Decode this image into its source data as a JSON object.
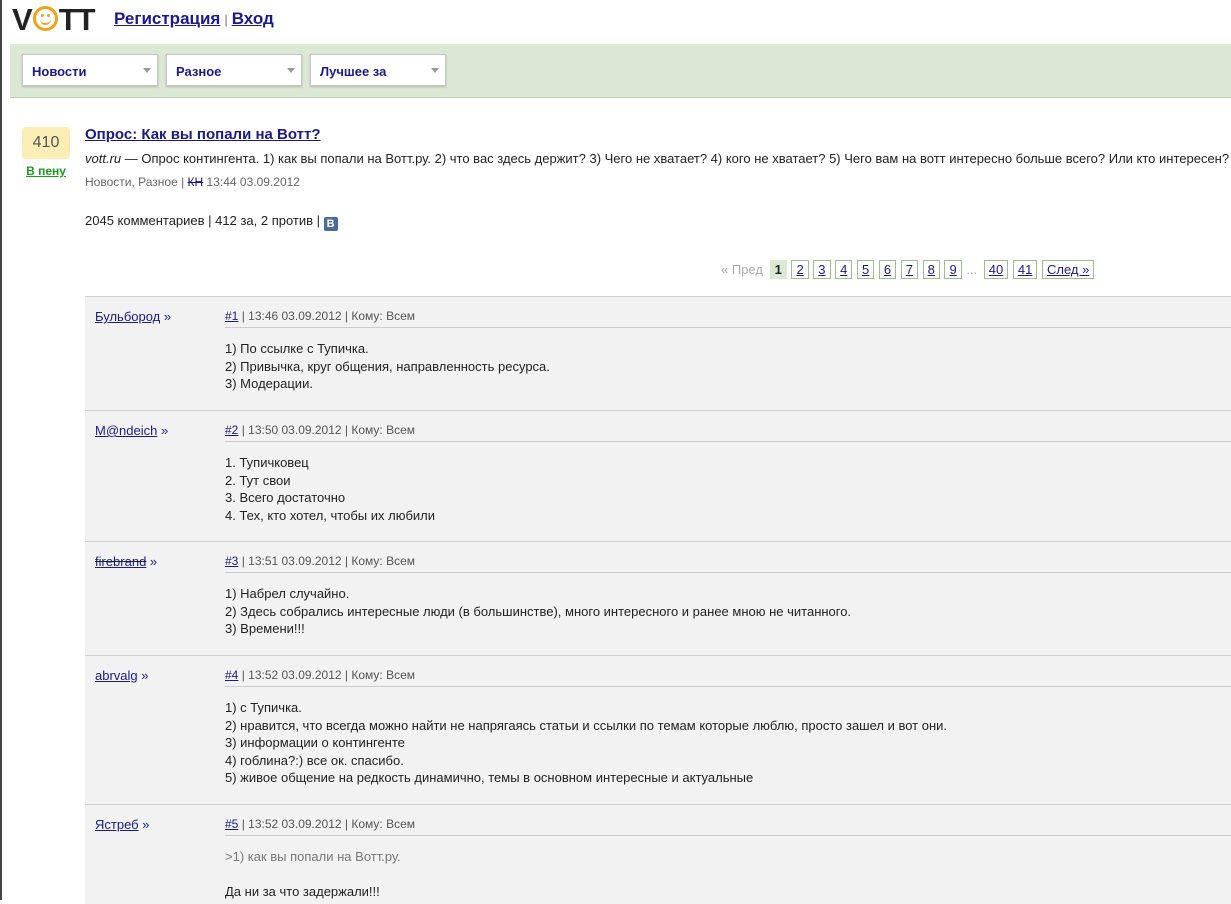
{
  "header": {
    "logo": {
      "part1": "V",
      "part2": "TT"
    },
    "register": "Регистрация",
    "separator": "|",
    "login": "Вход"
  },
  "nav": {
    "dropdowns": [
      {
        "label": "Новости"
      },
      {
        "label": "Разное"
      },
      {
        "label": "Лучшее за"
      }
    ]
  },
  "post": {
    "score": "410",
    "to_foam": "В пену",
    "title": "Опрос: Как вы попали на Вотт?",
    "source": "vott.ru",
    "description": " — Опрос контингента. 1) как вы попали на Вотт.ру. 2) что вас здесь держит? 3) Чего не хватает? 4) кого не хватает? 5) Чего вам на вотт интересно больше всего? Или кто интересен?",
    "categories": "Новости, Разное |",
    "author": "КН",
    "datetime": "13:44 03.09.2012",
    "stats": "2045 комментариев | 412 за, 2 против |",
    "vk_icon": "В"
  },
  "pager": {
    "prev": "« Пред",
    "pages": [
      "1",
      "2",
      "3",
      "4",
      "5",
      "6",
      "7",
      "8",
      "9"
    ],
    "dots": "...",
    "last_pages": [
      "40",
      "41"
    ],
    "next": "След »"
  },
  "comments": [
    {
      "author": "Бульбород",
      "author_strike": false,
      "num": "#1",
      "meta": " | 13:46 03.09.2012 | Кому: Всем",
      "lines": [
        "1) По ссылке с Тупичка.",
        "2) Привычка, круг общения, направленность ресурса.",
        "3) Модерации."
      ]
    },
    {
      "author": "M@ndeich",
      "author_strike": false,
      "num": "#2",
      "meta": " | 13:50 03.09.2012 | Кому: Всем",
      "lines": [
        "1. Тупичковец",
        "2. Тут свои",
        "3. Всего достаточно",
        "4. Тех, кто хотел, чтобы их любили"
      ]
    },
    {
      "author": "firebrand",
      "author_strike": true,
      "num": "#3",
      "meta": " | 13:51 03.09.2012 | Кому: Всем",
      "lines": [
        "1) Набрел случайно.",
        "2) Здесь собрались интересные люди (в большинстве), много интересного и ранее мною не читанного.",
        "3) Времени!!!"
      ]
    },
    {
      "author": "abrvalg",
      "author_strike": false,
      "num": "#4",
      "meta": " | 13:52 03.09.2012 | Кому: Всем",
      "lines": [
        "1) с Тупичка.",
        "2) нравится, что всегда можно найти не напрягаясь статьи и ссылки по темам которые люблю, просто зашел и вот они.",
        "3) информации о контингенте",
        "4) гоблина?:) все ок. спасибо.",
        "5) живое общение на редкость динамично, темы в основном интересные и актуальные"
      ]
    },
    {
      "author": "Ястреб",
      "author_strike": false,
      "num": "#5",
      "meta": " | 13:52 03.09.2012 | Кому: Всем",
      "quote": ">1) как вы попали на Вотт.ру.",
      "lines": [
        "Да ни за что задержали!!!"
      ]
    }
  ],
  "author_suffix": " »"
}
